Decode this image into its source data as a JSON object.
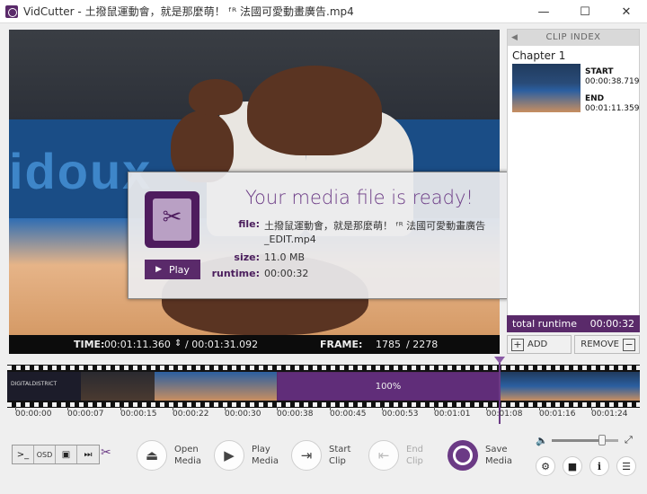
{
  "window": {
    "title": "VidCutter - 土撥鼠運動會，就是那麼萌！ ᶠᴿ 法國可愛動畫廣告.mp4",
    "minimize": "—",
    "maximize": "☐",
    "close": "✕"
  },
  "video_bar": {
    "time_label": "TIME:",
    "time_value": "00:01:11.360",
    "total_value": "/ 00:01:31.092",
    "frame_label": "FRAME:",
    "frame_value": "1785",
    "frame_total": "/ 2278"
  },
  "scene": {
    "banner_text": "idoux"
  },
  "dialog": {
    "title": "Your media file is ready!",
    "play_label": "Play",
    "file_label": "file:",
    "file_value_line1": "土撥鼠運動會，就是那麼萌！ ᶠᴿ 法國可愛動畫廣告",
    "file_value_line2": "_EDIT.mp4",
    "size_label": "size:",
    "size_value": "11.0 MB",
    "runtime_label": "runtime:",
    "runtime_value": "00:00:32"
  },
  "clip_index": {
    "header": "CLIP INDEX",
    "chapter": "Chapter 1",
    "start_label": "START",
    "start_value": "00:00:38.719",
    "end_label": "END",
    "end_value": "00:01:11.359",
    "total_runtime_label": "total runtime",
    "total_runtime_value": "00:00:32",
    "add_label": "ADD",
    "remove_label": "REMOVE"
  },
  "timeline": {
    "selection_label": "100%",
    "thumb_text": "DIGITALDISTRICT",
    "ticks": [
      "00:00:00",
      "00:00:07",
      "00:00:15",
      "00:00:22",
      "00:00:30",
      "00:00:38",
      "00:00:45",
      "00:00:53",
      "00:01:01",
      "00:01:08",
      "00:01:16",
      "00:01:24"
    ]
  },
  "toolbar": {
    "console": ">_",
    "osd": "OSD",
    "open_media": [
      "Open",
      "Media"
    ],
    "play_media": [
      "Play",
      "Media"
    ],
    "start_clip": [
      "Start",
      "Clip"
    ],
    "end_clip": [
      "End",
      "Clip"
    ],
    "save_media": [
      "Save",
      "Media"
    ],
    "volume_percent": 75
  },
  "icons": {
    "open": "⏏",
    "play": "▶",
    "start_clip": "⇥",
    "end_clip": "⇤",
    "settings": "⚙",
    "camera": "■",
    "info": "i",
    "menu": "☰",
    "volume": "🔈",
    "fullscreen": "⤢"
  },
  "colors": {
    "accent": "#6b3a85"
  }
}
